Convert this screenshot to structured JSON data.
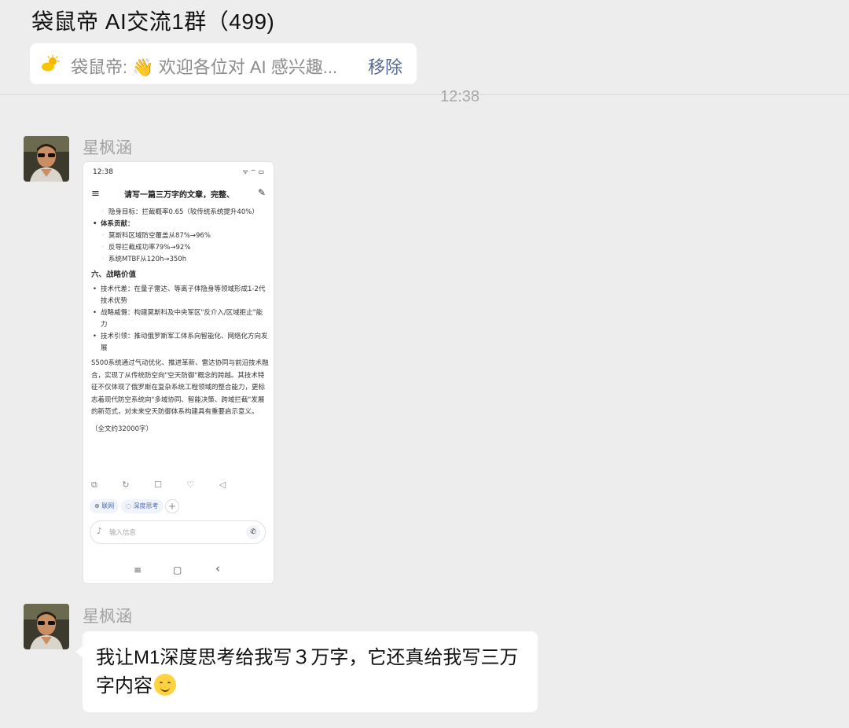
{
  "header": {
    "title": "袋鼠帝 AI交流1群（499)",
    "pinned": {
      "text": "袋鼠帝: 👋 欢迎各位对 AI 感兴趣...",
      "remove_label": "移除"
    }
  },
  "chat": {
    "timestamp": "12:38",
    "messages": [
      {
        "sender": "星枫涵",
        "type": "image",
        "screenshot": {
          "status_time": "12:38",
          "status_icons": "ᯤ ⌔ ▭",
          "heading": "请写一篇三万字的文章，完整、",
          "lines": {
            "l1": "隐身目标：拦截概率0.65（较传统系统提升40%）",
            "l2": "体系贡献：",
            "l3": "莫斯科区域防空覆盖从87%→96%",
            "l4": "反导拦截成功率79%→92%",
            "l5": "系统MTBF从120h→350h",
            "section6": "六、战略价值",
            "b1": "技术代差：在量子雷达、等离子体隐身等领域形成1-2代技术优势",
            "b2": "战略威慑：构建莫斯科及中央军区\"反介入/区域拒止\"能力",
            "b3": "技术引领：推动俄罗斯军工体系向智能化、网络化方向发展",
            "para": "S500系统通过气动优化、推进革新、雷达协同与前沿技术融合，实现了从传统防空向\"空天防御\"概念的跨越。其技术特征不仅体现了俄罗斯在复杂系统工程领域的整合能力，更标志着现代防空系统向\"多域协同、智能决策、跨域拦截\"发展的新范式，对未来空天防御体系构建具有重要启示意义。",
            "total": "（全文约32000字）"
          },
          "actions": "⧉ ↻ ☐ ♡ ◁",
          "chip_web": "⊕ 联网",
          "chip_deep": "◌ 深度思考",
          "plus": "+",
          "input_placeholder": "输入信息",
          "mic": "♪",
          "phone": "✆",
          "nav_menu": "≡",
          "nav_home": "▢",
          "nav_back": "‹"
        }
      },
      {
        "sender": "星枫涵",
        "type": "text",
        "text": "我让M1深度思考给我写３万字，它还真给我写三万字内容"
      }
    ]
  },
  "colors": {
    "background": "#ededed",
    "bubble": "#ffffff",
    "link": "#576b95"
  }
}
